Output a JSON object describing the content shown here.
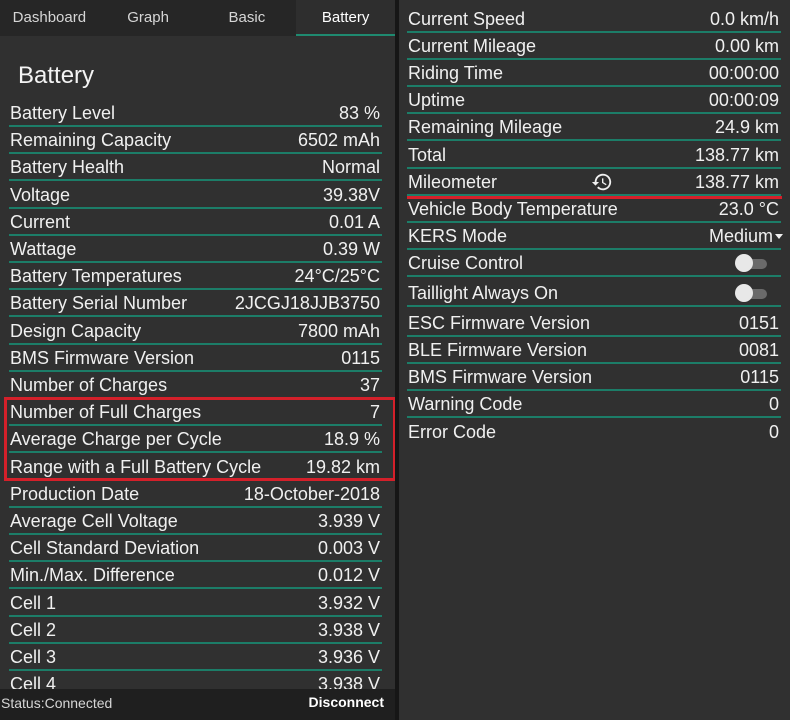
{
  "tabs": [
    "Dashboard",
    "Graph",
    "Basic",
    "Battery"
  ],
  "battery": {
    "title": "Battery",
    "rows": [
      {
        "label": "Battery Level",
        "value": "83 %"
      },
      {
        "label": "Remaining Capacity",
        "value": "6502 mAh"
      },
      {
        "label": "Battery Health",
        "value": "Normal"
      },
      {
        "label": "Voltage",
        "value": "39.38V"
      },
      {
        "label": "Current",
        "value": "0.01 A"
      },
      {
        "label": "Wattage",
        "value": "0.39 W"
      },
      {
        "label": "Battery Temperatures",
        "value": "24°C/25°C"
      },
      {
        "label": "Battery Serial Number",
        "value": "2JCGJ18JJB3750"
      },
      {
        "label": "Design Capacity",
        "value": "7800 mAh"
      },
      {
        "label": "BMS Firmware Version",
        "value": "0115"
      },
      {
        "label": "Number of Charges",
        "value": "37"
      },
      {
        "label": "Number of Full Charges",
        "value": "7"
      },
      {
        "label": "Average Charge per Cycle",
        "value": "18.9 %"
      },
      {
        "label": "Range with a Full Battery Cycle",
        "value": "19.82 km"
      },
      {
        "label": "Production Date",
        "value": "18-October-2018"
      },
      {
        "label": "Average Cell Voltage",
        "value": "3.939 V"
      },
      {
        "label": "Cell Standard Deviation",
        "value": "0.003 V"
      },
      {
        "label": "Min./Max. Difference",
        "value": "0.012 V"
      },
      {
        "label": "Cell 1",
        "value": "3.932 V"
      },
      {
        "label": "Cell 2",
        "value": "3.938 V"
      },
      {
        "label": "Cell 3",
        "value": "3.936 V"
      },
      {
        "label": "Cell 4",
        "value": "3.938 V"
      }
    ]
  },
  "basic": {
    "rows": [
      {
        "label": "Current Speed",
        "value": "0.0 km/h"
      },
      {
        "label": "Current Mileage",
        "value": "0.00 km"
      },
      {
        "label": "Riding Time",
        "value": "00:00:00"
      },
      {
        "label": "Uptime",
        "value": "00:00:09"
      },
      {
        "label": "Remaining Mileage",
        "value": "24.9 km"
      },
      {
        "label": "Total",
        "value": "138.77 km"
      },
      {
        "label": "Mileometer",
        "value": "138.77 km"
      },
      {
        "label": "Vehicle Body Temperature",
        "value": "23.0 °C"
      },
      {
        "label": "KERS Mode",
        "value": "Medium"
      },
      {
        "label": "Cruise Control",
        "value": ""
      },
      {
        "label": "Taillight Always On",
        "value": ""
      },
      {
        "label": "ESC Firmware Version",
        "value": "0151"
      },
      {
        "label": "BLE Firmware Version",
        "value": "0081"
      },
      {
        "label": "BMS Firmware Version",
        "value": "0115"
      },
      {
        "label": "Warning Code",
        "value": "0"
      },
      {
        "label": "Error Code",
        "value": "0"
      }
    ],
    "cruise_control_on": false,
    "taillight_on": false
  },
  "status": {
    "text": "Status:Connected",
    "disconnect_label": "Disconnect"
  },
  "colors": {
    "accent": "#1c7d68",
    "highlight": "#d4202a",
    "background": "#303030"
  }
}
